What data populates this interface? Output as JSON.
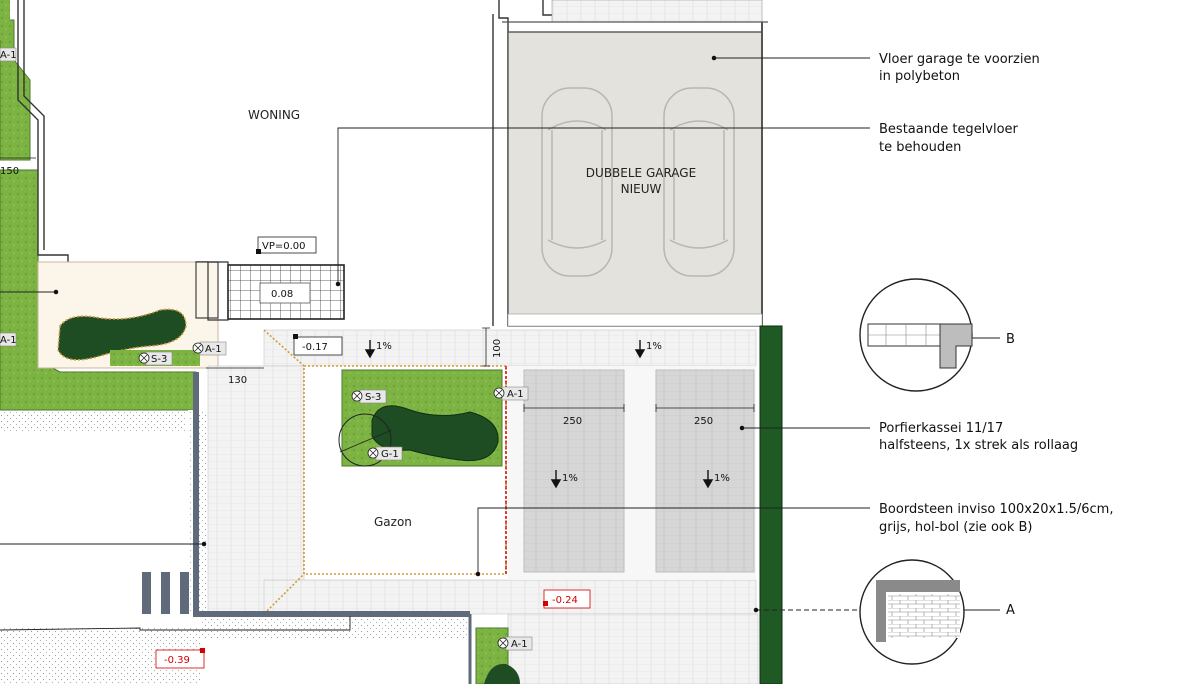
{
  "rooms": {
    "woning": "WONING",
    "garage_line1": "DUBBELE GARAGE",
    "garage_line2": "NIEUW",
    "gazon": "Gazon"
  },
  "levels": {
    "vp": "VP=0.00",
    "entrance": "0.08",
    "terrace": "-0.17",
    "path": "-0.24",
    "street": "-0.39"
  },
  "dimensions": {
    "side_left": "150",
    "gap": "130",
    "strip": "100",
    "parking_1": "250",
    "parking_2": "250"
  },
  "slopes": {
    "s1": "1%",
    "s2": "1%",
    "s3": "1%",
    "s4": "1%"
  },
  "plant_tags": {
    "a1": "A-1",
    "s3": "S-3",
    "g1": "G-1"
  },
  "annotations": {
    "garage_floor_l1": "Vloer garage te voorzien",
    "garage_floor_l2": "in polybeton",
    "tiles_l1": "Bestaande tegelvloer",
    "tiles_l2": "te behouden",
    "porphyry_l1": "Porfierkassei 11/17",
    "porphyry_l2": "halfsteens, 1x strek als rollaag",
    "kerb_l1": "Boordsteen inviso 100x20x1.5/6cm,",
    "kerb_l2": "grijs, hol-bol (zie ook B)"
  },
  "details": {
    "a": "A",
    "b": "B"
  },
  "colors": {
    "grass": "#7cb342",
    "planting_bed": "#1e4d23",
    "hedge": "#1f5a24",
    "paving": "#f1f1f1",
    "garage_floor": "#e4e2dc",
    "parking": "#d4d4d4",
    "wall": "#5f6b7a",
    "level_red": "#d40000"
  }
}
